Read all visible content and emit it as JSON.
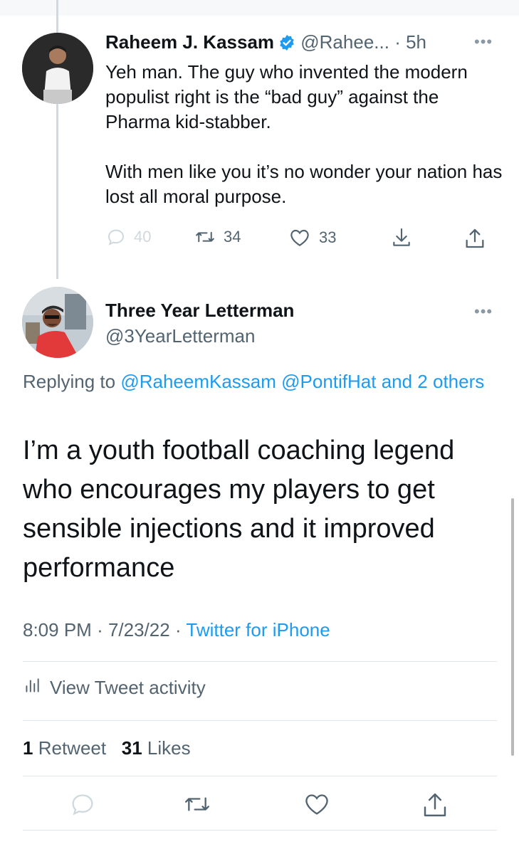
{
  "parent_tweet": {
    "author_name": "Raheem J. Kassam",
    "author_handle": "@Rahee...",
    "time": "· 5h",
    "paragraphs": [
      "Yeh man. The guy who invented the modern populist right is the “bad guy” against the Pharma kid-stabber.",
      "With men like you it’s no wonder your nation has lost all moral purpose."
    ],
    "reply_count": "40",
    "retweet_count": "34",
    "like_count": "33"
  },
  "main_tweet": {
    "author_name": "Three Year Letterman",
    "author_handle": "@3YearLetterman",
    "replying_prefix": "Replying to",
    "replying_users": "@RaheemKassam @PontifHat",
    "replying_others": "and 2 others",
    "text": "I’m a youth football coaching legend who encourages my players to get sensible injections and it improved performance",
    "time": "8:09 PM",
    "date": "7/23/22",
    "source": "Twitter for iPhone",
    "activity_label": "View Tweet activity",
    "retweets_number": "1",
    "retweets_label": "Retweet",
    "likes_number": "31",
    "likes_label": "Likes"
  },
  "colors": {
    "accent": "#1d9bf0",
    "muted": "#536471",
    "text": "#0f1419"
  },
  "icons": [
    "verified-badge-icon",
    "more-icon",
    "reply-icon",
    "retweet-icon",
    "like-icon",
    "bookmark-download-icon",
    "share-icon",
    "activity-bars-icon"
  ]
}
